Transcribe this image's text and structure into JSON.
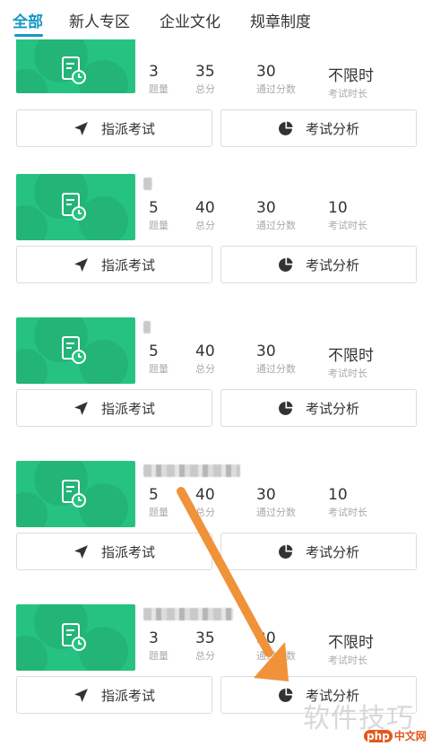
{
  "tabs": [
    {
      "label": "全部",
      "active": true
    },
    {
      "label": "新人专区",
      "active": false
    },
    {
      "label": "企业文化",
      "active": false
    },
    {
      "label": "规章制度",
      "active": false
    }
  ],
  "stat_labels": {
    "count": "题量",
    "total": "总分",
    "pass": "通过分数",
    "duration": "考试时长"
  },
  "buttons": {
    "assign": "指派考试",
    "analysis": "考试分析"
  },
  "exams": [
    {
      "count": "3",
      "total": "35",
      "pass": "30",
      "duration": "不限时"
    },
    {
      "count": "5",
      "total": "40",
      "pass": "30",
      "duration": "10"
    },
    {
      "count": "5",
      "total": "40",
      "pass": "30",
      "duration": "不限时"
    },
    {
      "count": "5",
      "total": "40",
      "pass": "30",
      "duration": "10"
    },
    {
      "count": "3",
      "total": "35",
      "pass": "30",
      "duration": "不限时"
    }
  ],
  "watermark": "软件技巧",
  "logo": {
    "badge": "php",
    "text": "中文网"
  },
  "colors": {
    "accent": "#1597c3",
    "thumb": "#26c281",
    "arrow": "#f0923a"
  }
}
